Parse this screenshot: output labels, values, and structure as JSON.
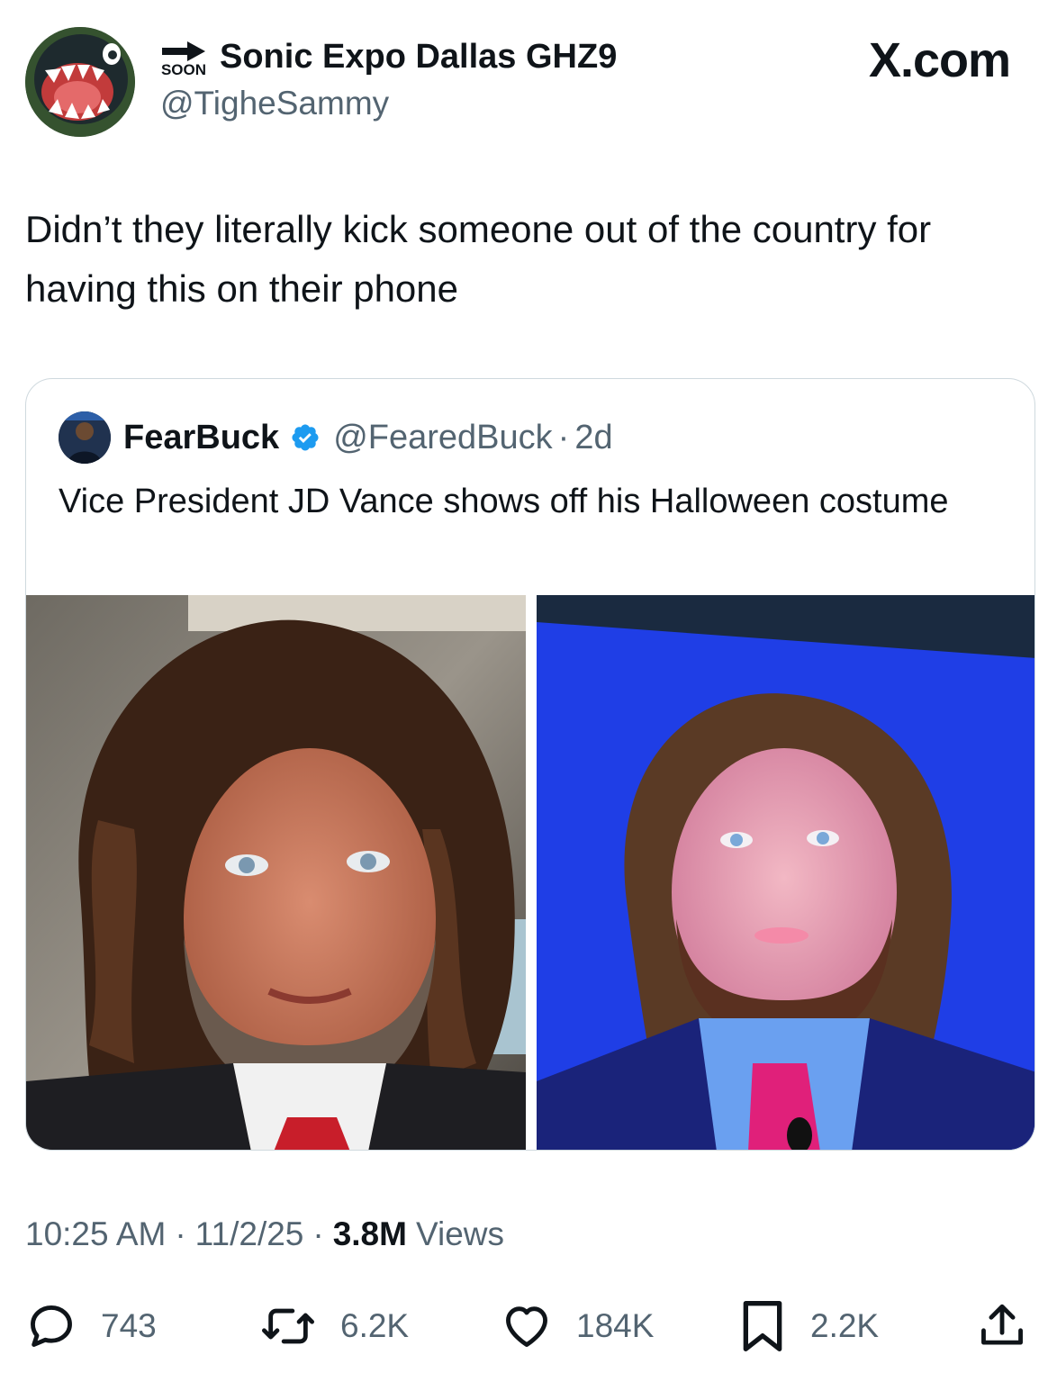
{
  "author": {
    "display_name": "Sonic Expo Dallas GHZ9",
    "handle": "@TigheSammy",
    "badge_text": "SOON"
  },
  "brand": {
    "site": "X.com"
  },
  "tweet": {
    "text": "Didn’t they literally kick someone out of the country for having this on their phone"
  },
  "quoted": {
    "display_name": "FearBuck",
    "handle": "@FearedBuck",
    "separator": "·",
    "age": "2d",
    "text": "Vice President JD Vance shows off his Halloween costume"
  },
  "meta": {
    "time": "10:25 AM",
    "date": "11/2/25",
    "views_count": "3.8M",
    "views_label": "Views",
    "separator": "·"
  },
  "actions": {
    "replies": "743",
    "reposts": "6.2K",
    "likes": "184K",
    "bookmarks": "2.2K"
  },
  "colors": {
    "text_primary": "#0f1419",
    "text_secondary": "#536471",
    "verified": "#1d9bf0",
    "border": "#cfd9de"
  }
}
